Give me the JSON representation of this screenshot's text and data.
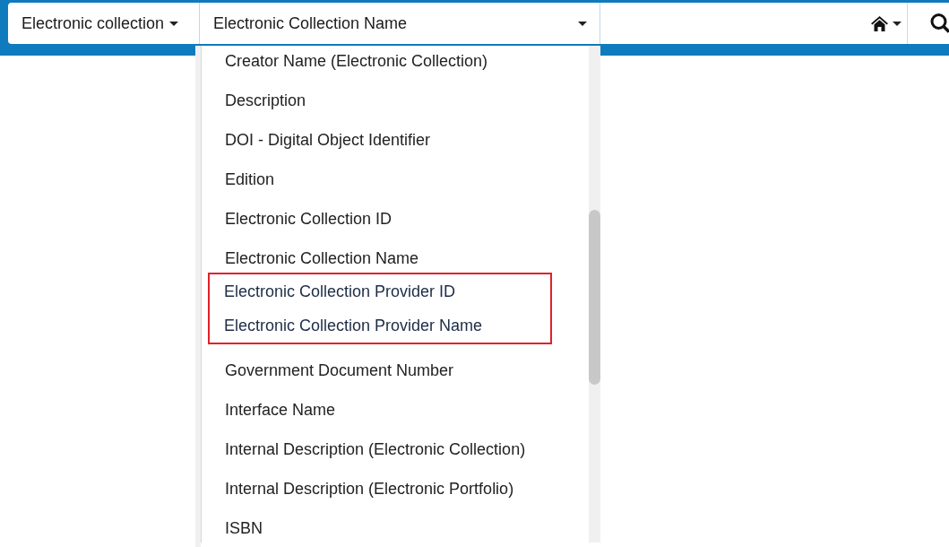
{
  "search_bar": {
    "scope": {
      "label": "Electronic collection"
    },
    "field": {
      "label": "Electronic Collection Name",
      "expanded": true
    }
  },
  "field_menu": {
    "items": [
      {
        "label": "Creator Name (Electronic Collection)",
        "highlighted": false
      },
      {
        "label": "Description",
        "highlighted": false
      },
      {
        "label": "DOI - Digital Object Identifier",
        "highlighted": false
      },
      {
        "label": "Edition",
        "highlighted": false
      },
      {
        "label": "Electronic Collection ID",
        "highlighted": false
      },
      {
        "label": "Electronic Collection Name",
        "highlighted": false
      },
      {
        "label": "Electronic Collection Provider ID",
        "highlighted": true
      },
      {
        "label": "Electronic Collection Provider Name",
        "highlighted": true
      },
      {
        "label": "Government Document Number",
        "highlighted": false
      },
      {
        "label": "Interface Name",
        "highlighted": false
      },
      {
        "label": "Internal Description (Electronic Collection)",
        "highlighted": false
      },
      {
        "label": "Internal Description (Electronic Portfolio)",
        "highlighted": false
      },
      {
        "label": "ISBN",
        "highlighted": false
      }
    ]
  }
}
